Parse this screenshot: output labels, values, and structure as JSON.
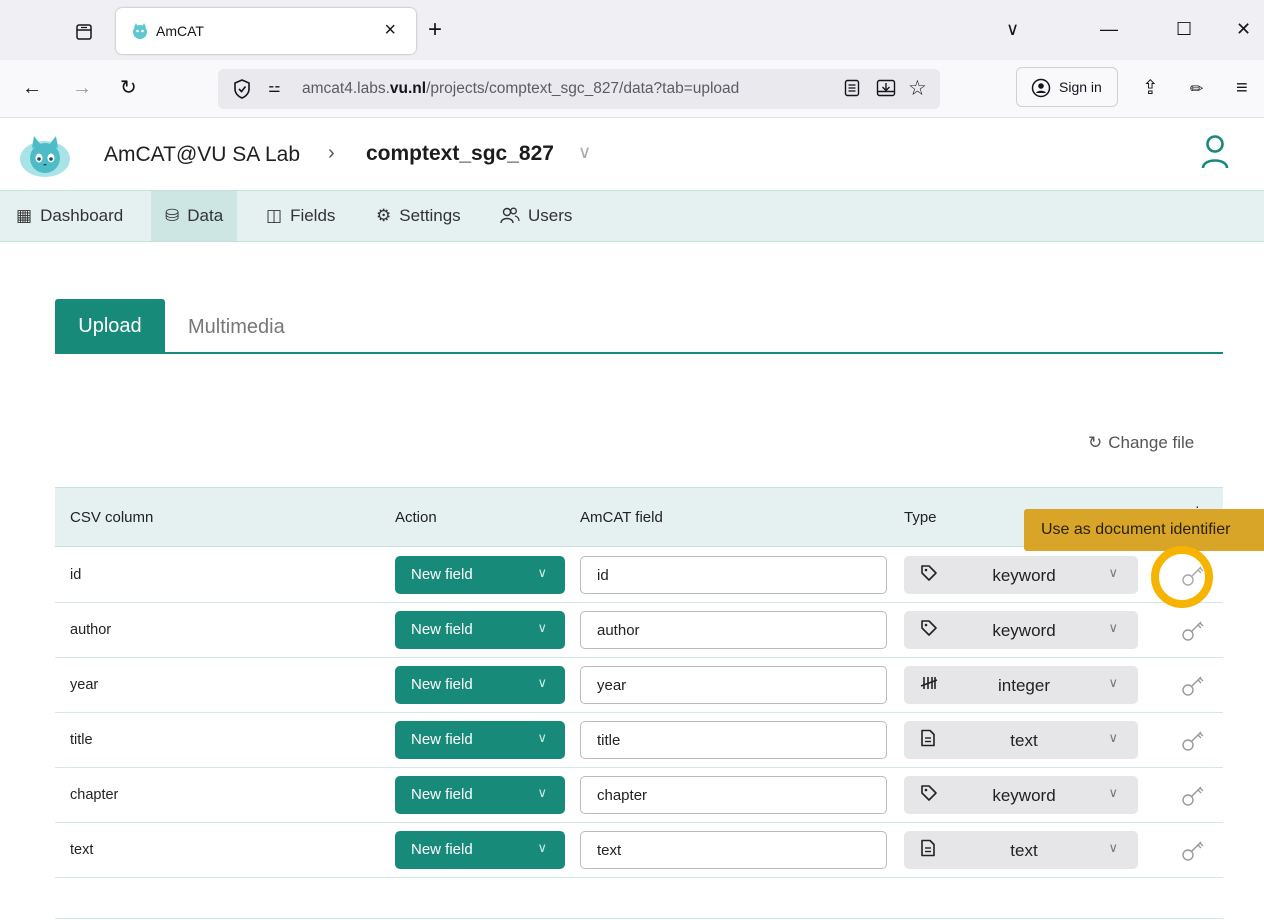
{
  "browser": {
    "tab_title": "AmCAT",
    "tab_close": "×",
    "new_tab": "+",
    "window_controls": [
      "∨",
      "—",
      "☐",
      "✕"
    ],
    "url_prefix": "amcat4.labs.",
    "url_domain": "vu.nl",
    "url_path": "/projects/comptext_sgc_827/data?tab=upload",
    "sign_in": "Sign in"
  },
  "header": {
    "app_name": "AmCAT@VU SA Lab",
    "separator": "›",
    "project_name": "comptext_sgc_827",
    "project_chevron": "∨"
  },
  "subnav": {
    "items": [
      {
        "label": "Dashboard",
        "icon": "dashboard-icon",
        "glyph": "▦"
      },
      {
        "label": "Data",
        "icon": "database-icon",
        "glyph": "⛁"
      },
      {
        "label": "Fields",
        "icon": "fields-icon",
        "glyph": "◫"
      },
      {
        "label": "Settings",
        "icon": "gear-icon",
        "glyph": "⚙"
      },
      {
        "label": "Users",
        "icon": "users-icon",
        "glyph": "👥"
      }
    ],
    "active": "Data"
  },
  "upload": {
    "tabs": [
      "Upload",
      "Multimedia"
    ],
    "active_tab": "Upload",
    "change_file": "Change file"
  },
  "table": {
    "headers": [
      "CSV column",
      "Action",
      "AmCAT field",
      "Type"
    ],
    "header_extra": "·",
    "rows": [
      {
        "csv": "id",
        "action": "New field",
        "field": "id",
        "type": "keyword",
        "type_icon": "tag-icon",
        "type_glyph": "⬡"
      },
      {
        "csv": "author",
        "action": "New field",
        "field": "author",
        "type": "keyword",
        "type_icon": "tag-icon",
        "type_glyph": "⬡"
      },
      {
        "csv": "year",
        "action": "New field",
        "field": "year",
        "type": "integer",
        "type_icon": "tally-icon",
        "type_glyph": "卌"
      },
      {
        "csv": "title",
        "action": "New field",
        "field": "title",
        "type": "text",
        "type_icon": "document-icon",
        "type_glyph": "🗎"
      },
      {
        "csv": "chapter",
        "action": "New field",
        "field": "chapter",
        "type": "keyword",
        "type_icon": "tag-icon",
        "type_glyph": "⬡"
      },
      {
        "csv": "text",
        "action": "New field",
        "field": "text",
        "type": "text",
        "type_icon": "document-icon",
        "type_glyph": "🗎"
      }
    ]
  },
  "tooltip": "Use as document identifier",
  "colors": {
    "accent": "#178a7a",
    "subnav_bg": "#e4f1f0",
    "tooltip_bg": "#d9a528",
    "highlight": "#f6b300"
  }
}
